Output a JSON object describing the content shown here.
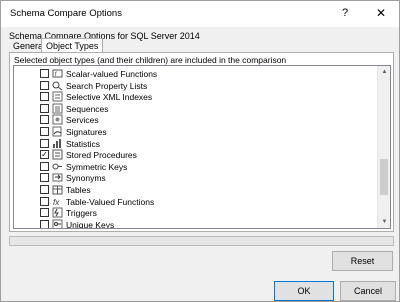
{
  "window": {
    "title": "Schema Compare Options",
    "help_label": "?",
    "close_label": "✕"
  },
  "heading": "Schema Compare Options for SQL Server 2014",
  "tabs": [
    {
      "label": "General"
    },
    {
      "label": "Object Types",
      "selected": true
    }
  ],
  "panel": {
    "description": "Selected object types (and their children) are included in the comparison"
  },
  "object_types": [
    {
      "label": "Scalar-valued Functions",
      "icon": "function-icon",
      "checked": false
    },
    {
      "label": "Search Property Lists",
      "icon": "search-property-icon",
      "checked": false
    },
    {
      "label": "Selective XML Indexes",
      "icon": "xml-index-icon",
      "checked": false
    },
    {
      "label": "Sequences",
      "icon": "sequence-icon",
      "checked": false
    },
    {
      "label": "Services",
      "icon": "service-icon",
      "checked": false
    },
    {
      "label": "Signatures",
      "icon": "signature-icon",
      "checked": false
    },
    {
      "label": "Statistics",
      "icon": "statistics-icon",
      "checked": false
    },
    {
      "label": "Stored Procedures",
      "icon": "stored-procedure-icon",
      "checked": true
    },
    {
      "label": "Symmetric Keys",
      "icon": "key-icon",
      "checked": false
    },
    {
      "label": "Synonyms",
      "icon": "synonym-icon",
      "checked": false
    },
    {
      "label": "Tables",
      "icon": "table-icon",
      "checked": false
    },
    {
      "label": "Table-Valued Functions",
      "icon": "table-function-icon",
      "checked": false
    },
    {
      "label": "Triggers",
      "icon": "trigger-icon",
      "checked": false
    },
    {
      "label": "Unique Keys",
      "icon": "unique-key-icon",
      "checked": false
    }
  ],
  "buttons": {
    "reset": "Reset",
    "ok": "OK",
    "cancel": "Cancel"
  },
  "colors": {
    "accent": "#0078d7",
    "checked_border": "#333333"
  }
}
